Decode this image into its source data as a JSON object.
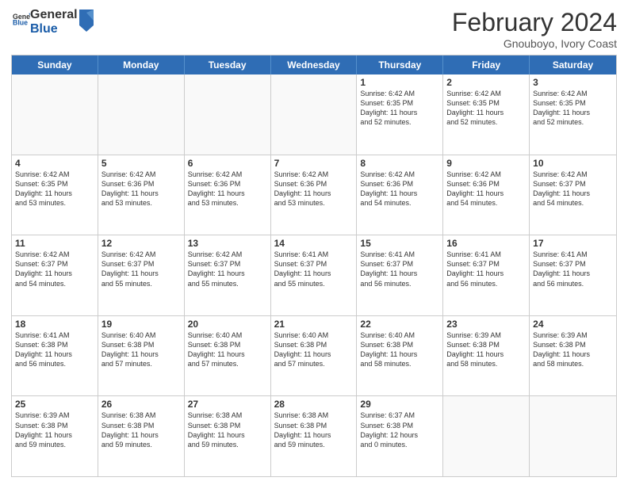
{
  "header": {
    "logo_general": "General",
    "logo_blue": "Blue",
    "month_year": "February 2024",
    "location": "Gnouboyo, Ivory Coast"
  },
  "days_of_week": [
    "Sunday",
    "Monday",
    "Tuesday",
    "Wednesday",
    "Thursday",
    "Friday",
    "Saturday"
  ],
  "rows": [
    [
      {
        "day": "",
        "info": ""
      },
      {
        "day": "",
        "info": ""
      },
      {
        "day": "",
        "info": ""
      },
      {
        "day": "",
        "info": ""
      },
      {
        "day": "1",
        "info": "Sunrise: 6:42 AM\nSunset: 6:35 PM\nDaylight: 11 hours\nand 52 minutes."
      },
      {
        "day": "2",
        "info": "Sunrise: 6:42 AM\nSunset: 6:35 PM\nDaylight: 11 hours\nand 52 minutes."
      },
      {
        "day": "3",
        "info": "Sunrise: 6:42 AM\nSunset: 6:35 PM\nDaylight: 11 hours\nand 52 minutes."
      }
    ],
    [
      {
        "day": "4",
        "info": "Sunrise: 6:42 AM\nSunset: 6:35 PM\nDaylight: 11 hours\nand 53 minutes."
      },
      {
        "day": "5",
        "info": "Sunrise: 6:42 AM\nSunset: 6:36 PM\nDaylight: 11 hours\nand 53 minutes."
      },
      {
        "day": "6",
        "info": "Sunrise: 6:42 AM\nSunset: 6:36 PM\nDaylight: 11 hours\nand 53 minutes."
      },
      {
        "day": "7",
        "info": "Sunrise: 6:42 AM\nSunset: 6:36 PM\nDaylight: 11 hours\nand 53 minutes."
      },
      {
        "day": "8",
        "info": "Sunrise: 6:42 AM\nSunset: 6:36 PM\nDaylight: 11 hours\nand 54 minutes."
      },
      {
        "day": "9",
        "info": "Sunrise: 6:42 AM\nSunset: 6:36 PM\nDaylight: 11 hours\nand 54 minutes."
      },
      {
        "day": "10",
        "info": "Sunrise: 6:42 AM\nSunset: 6:37 PM\nDaylight: 11 hours\nand 54 minutes."
      }
    ],
    [
      {
        "day": "11",
        "info": "Sunrise: 6:42 AM\nSunset: 6:37 PM\nDaylight: 11 hours\nand 54 minutes."
      },
      {
        "day": "12",
        "info": "Sunrise: 6:42 AM\nSunset: 6:37 PM\nDaylight: 11 hours\nand 55 minutes."
      },
      {
        "day": "13",
        "info": "Sunrise: 6:42 AM\nSunset: 6:37 PM\nDaylight: 11 hours\nand 55 minutes."
      },
      {
        "day": "14",
        "info": "Sunrise: 6:41 AM\nSunset: 6:37 PM\nDaylight: 11 hours\nand 55 minutes."
      },
      {
        "day": "15",
        "info": "Sunrise: 6:41 AM\nSunset: 6:37 PM\nDaylight: 11 hours\nand 56 minutes."
      },
      {
        "day": "16",
        "info": "Sunrise: 6:41 AM\nSunset: 6:37 PM\nDaylight: 11 hours\nand 56 minutes."
      },
      {
        "day": "17",
        "info": "Sunrise: 6:41 AM\nSunset: 6:37 PM\nDaylight: 11 hours\nand 56 minutes."
      }
    ],
    [
      {
        "day": "18",
        "info": "Sunrise: 6:41 AM\nSunset: 6:38 PM\nDaylight: 11 hours\nand 56 minutes."
      },
      {
        "day": "19",
        "info": "Sunrise: 6:40 AM\nSunset: 6:38 PM\nDaylight: 11 hours\nand 57 minutes."
      },
      {
        "day": "20",
        "info": "Sunrise: 6:40 AM\nSunset: 6:38 PM\nDaylight: 11 hours\nand 57 minutes."
      },
      {
        "day": "21",
        "info": "Sunrise: 6:40 AM\nSunset: 6:38 PM\nDaylight: 11 hours\nand 57 minutes."
      },
      {
        "day": "22",
        "info": "Sunrise: 6:40 AM\nSunset: 6:38 PM\nDaylight: 11 hours\nand 58 minutes."
      },
      {
        "day": "23",
        "info": "Sunrise: 6:39 AM\nSunset: 6:38 PM\nDaylight: 11 hours\nand 58 minutes."
      },
      {
        "day": "24",
        "info": "Sunrise: 6:39 AM\nSunset: 6:38 PM\nDaylight: 11 hours\nand 58 minutes."
      }
    ],
    [
      {
        "day": "25",
        "info": "Sunrise: 6:39 AM\nSunset: 6:38 PM\nDaylight: 11 hours\nand 59 minutes."
      },
      {
        "day": "26",
        "info": "Sunrise: 6:38 AM\nSunset: 6:38 PM\nDaylight: 11 hours\nand 59 minutes."
      },
      {
        "day": "27",
        "info": "Sunrise: 6:38 AM\nSunset: 6:38 PM\nDaylight: 11 hours\nand 59 minutes."
      },
      {
        "day": "28",
        "info": "Sunrise: 6:38 AM\nSunset: 6:38 PM\nDaylight: 11 hours\nand 59 minutes."
      },
      {
        "day": "29",
        "info": "Sunrise: 6:37 AM\nSunset: 6:38 PM\nDaylight: 12 hours\nand 0 minutes."
      },
      {
        "day": "",
        "info": ""
      },
      {
        "day": "",
        "info": ""
      }
    ]
  ]
}
